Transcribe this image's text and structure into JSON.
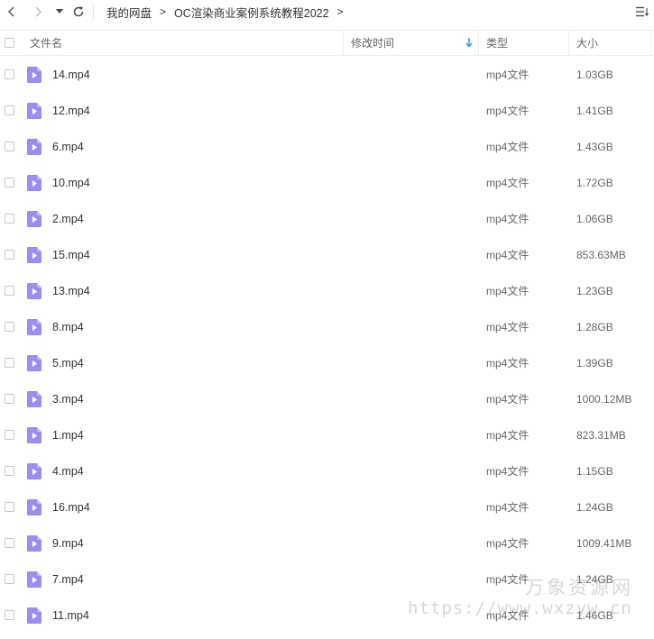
{
  "breadcrumb": {
    "items": [
      "我的网盘",
      "OC渲染商业案例系统教程2022"
    ],
    "separator": ">"
  },
  "columns": {
    "name": "文件名",
    "modified": "修改时间",
    "type": "类型",
    "size": "大小"
  },
  "colors": {
    "icon": "#9b8cf0",
    "sort_arrow": "#2b8ff0"
  },
  "files": [
    {
      "name": "14.mp4",
      "modified": "",
      "type": "mp4文件",
      "size": "1.03GB"
    },
    {
      "name": "12.mp4",
      "modified": "",
      "type": "mp4文件",
      "size": "1.41GB"
    },
    {
      "name": "6.mp4",
      "modified": "",
      "type": "mp4文件",
      "size": "1.43GB"
    },
    {
      "name": "10.mp4",
      "modified": "",
      "type": "mp4文件",
      "size": "1.72GB"
    },
    {
      "name": "2.mp4",
      "modified": "",
      "type": "mp4文件",
      "size": "1.06GB"
    },
    {
      "name": "15.mp4",
      "modified": "",
      "type": "mp4文件",
      "size": "853.63MB"
    },
    {
      "name": "13.mp4",
      "modified": "",
      "type": "mp4文件",
      "size": "1.23GB"
    },
    {
      "name": "8.mp4",
      "modified": "",
      "type": "mp4文件",
      "size": "1.28GB"
    },
    {
      "name": "5.mp4",
      "modified": "",
      "type": "mp4文件",
      "size": "1.39GB"
    },
    {
      "name": "3.mp4",
      "modified": "",
      "type": "mp4文件",
      "size": "1000.12MB"
    },
    {
      "name": "1.mp4",
      "modified": "",
      "type": "mp4文件",
      "size": "823.31MB"
    },
    {
      "name": "4.mp4",
      "modified": "",
      "type": "mp4文件",
      "size": "1.15GB"
    },
    {
      "name": "16.mp4",
      "modified": "",
      "type": "mp4文件",
      "size": "1.24GB"
    },
    {
      "name": "9.mp4",
      "modified": "",
      "type": "mp4文件",
      "size": "1009.41MB"
    },
    {
      "name": "7.mp4",
      "modified": "",
      "type": "mp4文件",
      "size": "1.24GB"
    },
    {
      "name": "11.mp4",
      "modified": "",
      "type": "mp4文件",
      "size": "1.46GB"
    }
  ],
  "watermark": {
    "cn": "万象资源网",
    "url": "https://www.wxzyw.cn"
  }
}
